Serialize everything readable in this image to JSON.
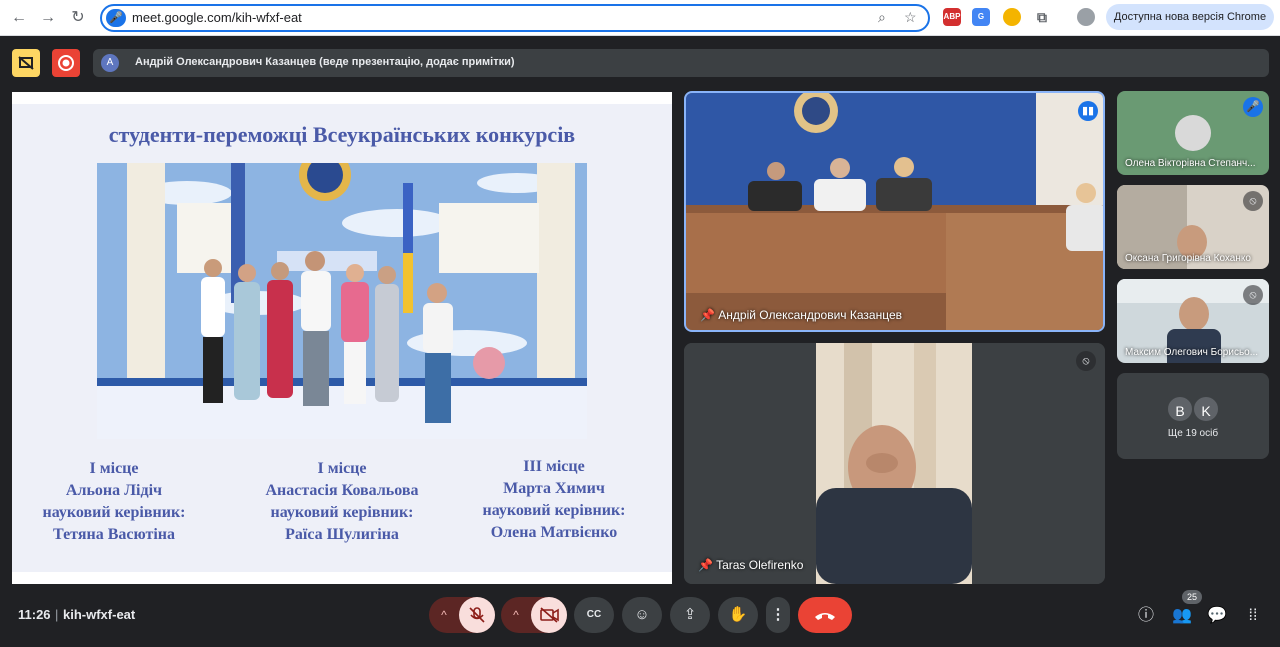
{
  "browser": {
    "url": "meet.google.com/kih-wfxf-eat",
    "update_label": "Доступна нова версія Chrome",
    "extensions": [
      "ABP"
    ]
  },
  "meet": {
    "presenter_banner": "Андрій Олександрович Казанцев (веде презентацію, додає примітки)",
    "presenter_initial": "A",
    "slide": {
      "title": "студенти-переможці Всеукраїнських конкурсів",
      "winners": [
        {
          "place": "I місце",
          "name": "Альона Лідіч",
          "role": "науковий керівник:",
          "supervisor": "Тетяна Васютіна"
        },
        {
          "place": "I місце",
          "name": "Анастасія Ковальова",
          "role": "науковий керівник:",
          "supervisor": "Раїса Шулигіна"
        },
        {
          "place": "III місце",
          "name": "Марта Химич",
          "role": "науковий керівник:",
          "supervisor": "Олена Матвієнко"
        }
      ]
    },
    "tiles": {
      "main_speaker": "Андрій Олександрович Казанцев",
      "second_speaker": "Taras Olefirenko",
      "side": [
        "Олена Вікторівна Степанч...",
        "Оксана Григорівна Коханко",
        "Максим Олегович Борисьо..."
      ],
      "more_initials": [
        "B",
        "K"
      ],
      "more_label": "Ще 19 осіб"
    },
    "bottom": {
      "time": "11:26",
      "code": "kih-wfxf-eat",
      "participant_count": "25"
    }
  },
  "colors": {
    "accent": "#1a73e8",
    "end_call": "#ea4335",
    "slide_text": "#4a5aa8",
    "mic_off_bg": "#f9dedc"
  }
}
